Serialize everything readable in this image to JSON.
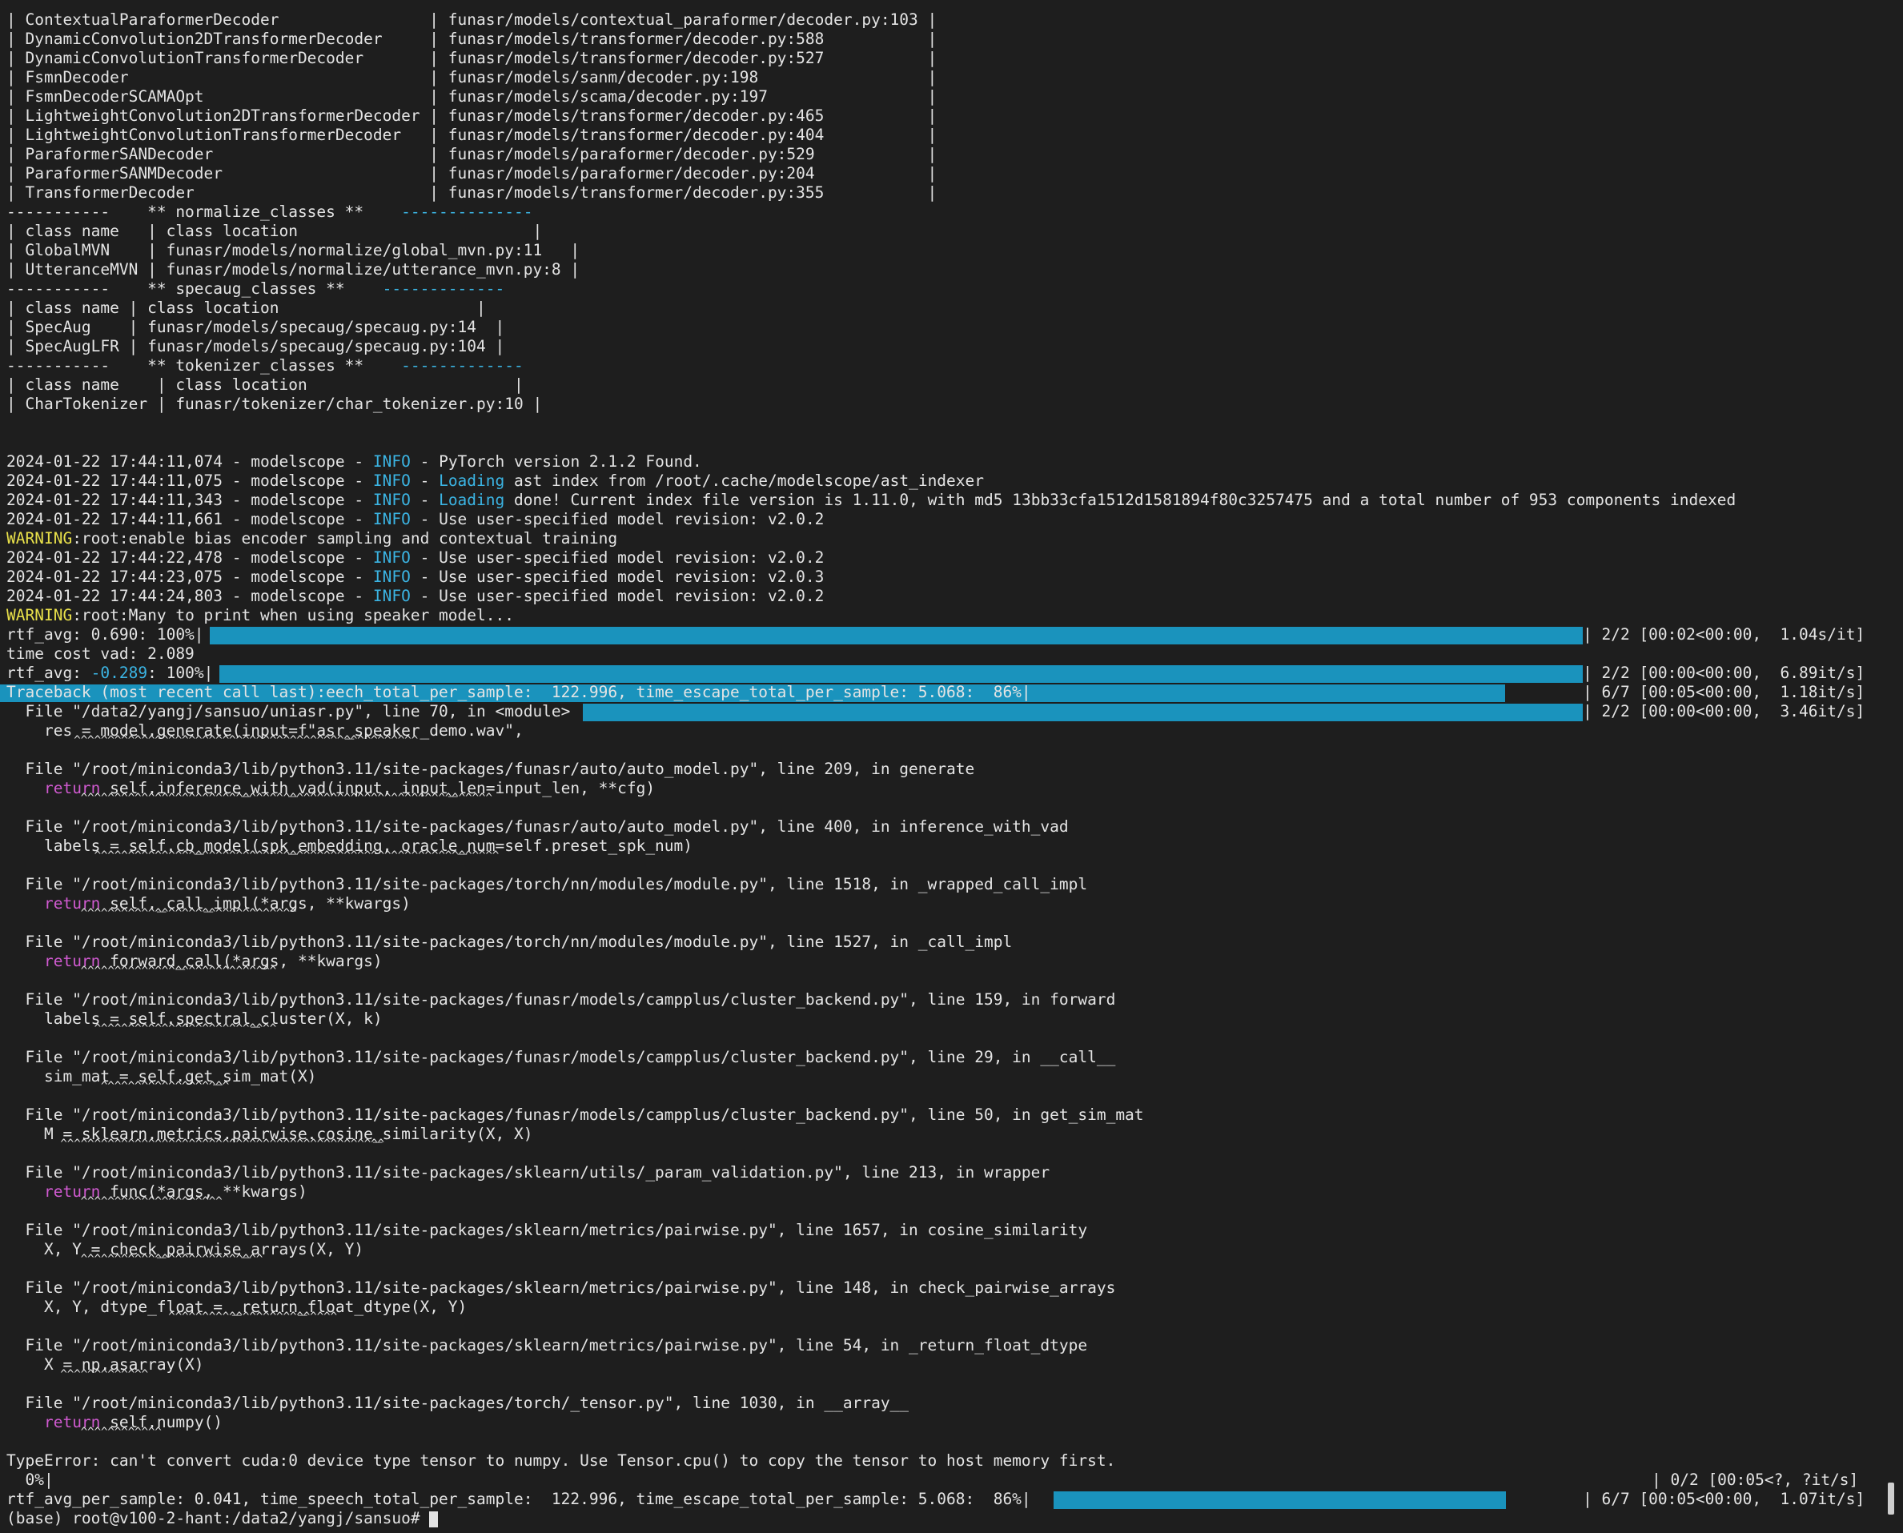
{
  "terminal": {
    "lines": [
      {
        "id": "l01",
        "t": "| ContextualParaformerDecoder                | funasr/models/contextual_paraformer/decoder.py:103 |"
      },
      {
        "id": "l02",
        "t": "| DynamicConvolution2DTransformerDecoder     | funasr/models/transformer/decoder.py:588           |"
      },
      {
        "id": "l03",
        "t": "| DynamicConvolutionTransformerDecoder       | funasr/models/transformer/decoder.py:527           |"
      },
      {
        "id": "l04",
        "t": "| FsmnDecoder                                | funasr/models/sanm/decoder.py:198                  |"
      },
      {
        "id": "l05",
        "t": "| FsmnDecoderSCAMAOpt                        | funasr/models/scama/decoder.py:197                 |"
      },
      {
        "id": "l06",
        "t": "| LightweightConvolution2DTransformerDecoder | funasr/models/transformer/decoder.py:465           |"
      },
      {
        "id": "l07",
        "t": "| LightweightConvolutionTransformerDecoder   | funasr/models/transformer/decoder.py:404           |"
      },
      {
        "id": "l08",
        "t": "| ParaformerSANDecoder                       | funasr/models/paraformer/decoder.py:529            |"
      },
      {
        "id": "l09",
        "t": "| ParaformerSANMDecoder                      | funasr/models/paraformer/decoder.py:204            |"
      },
      {
        "id": "l10",
        "t": "| TransformerDecoder                         | funasr/models/transformer/decoder.py:355           |"
      },
      {
        "id": "l11a",
        "t": "-----------    ** normalize_classes **    ",
        "b": "--------------"
      },
      {
        "id": "l12",
        "t": "| class name   | class location                         |"
      },
      {
        "id": "l13",
        "t": "| GlobalMVN    | funasr/models/normalize/global_mvn.py:11   |"
      },
      {
        "id": "l14",
        "t": "| UtteranceMVN | funasr/models/normalize/utterance_mvn.py:8 |"
      },
      {
        "id": "l15a",
        "t": "-----------    ** specaug_classes **    ",
        "b": "-------------"
      },
      {
        "id": "l16",
        "t": "| class name | class location                     |"
      },
      {
        "id": "l17",
        "t": "| SpecAug    | funasr/models/specaug/specaug.py:14  |"
      },
      {
        "id": "l18",
        "t": "| SpecAugLFR | funasr/models/specaug/specaug.py:104 |"
      },
      {
        "id": "l19a",
        "t": "-----------    ** tokenizer_classes **    ",
        "b": "-------------"
      },
      {
        "id": "l20",
        "t": "| class name    | class location                      |"
      },
      {
        "id": "l21",
        "t": "| CharTokenizer | funasr/tokenizer/char_tokenizer.py:10 |"
      }
    ],
    "logs": [
      {
        "pre": "2024-01-22 17:44:11,074 - modelscope - ",
        "lvl": "INFO",
        "mid": " - ",
        "hl": "",
        "post": "PyTorch version 2.1.2 Found."
      },
      {
        "pre": "2024-01-22 17:44:11,075 - modelscope - ",
        "lvl": "INFO",
        "mid": " - ",
        "hl": "Loading",
        "post": " ast index from /root/.cache/modelscope/ast_indexer"
      },
      {
        "pre": "2024-01-22 17:44:11,343 - modelscope - ",
        "lvl": "INFO",
        "mid": " - ",
        "hl": "Loading",
        "post": " done! Current index file version is 1.11.0, with md5 13bb33cfa1512d1581894f80c3257475 and a total number of 953 components indexed"
      },
      {
        "pre": "2024-01-22 17:44:11,661 - modelscope - ",
        "lvl": "INFO",
        "mid": " - ",
        "hl": "",
        "post": "Use user-specified model revision: v2.0.2"
      }
    ],
    "warning1": {
      "w": "WARNING",
      "rest": ":root:enable bias encoder sampling and contextual training"
    },
    "logs2": [
      {
        "pre": "2024-01-22 17:44:22,478 - modelscope - ",
        "lvl": "INFO",
        "post": " - Use user-specified model revision: v2.0.2"
      },
      {
        "pre": "2024-01-22 17:44:23,075 - modelscope - ",
        "lvl": "INFO",
        "post": " - Use user-specified model revision: v2.0.3"
      },
      {
        "pre": "2024-01-22 17:44:24,803 - modelscope - ",
        "lvl": "INFO",
        "post": " - Use user-specified model revision: v2.0.2"
      }
    ],
    "warning2": {
      "w": "WARNING",
      "rest": ":root:Many to print when using speaker model..."
    },
    "progress1": {
      "label": "rtf_avg: 0.690: 100%|",
      "right": "| 2/2 [00:02<00:00,  1.04s/it]",
      "fraction": 1.0
    },
    "timecost": "time cost vad: 2.089",
    "progress2": {
      "label_a": "rtf_avg: ",
      "label_neg": "-0.289",
      "label_b": ": 100%|",
      "right": "| 2/2 [00:00<00:00,  6.89it/s]",
      "fraction": 1.0
    },
    "progress3": {
      "label": "Traceback (most recent call last):eech_total_per_sample:  122.996, time_escape_total_per_sample: 5.068:  86%|",
      "right": "| 6/7 [00:05<00:00,  1.18it/s]",
      "fraction": 0.86
    },
    "progress4": {
      "label": "  File \"/data2/yangj/sansuo/uniasr.py\", line 70, in <module>",
      "right": "| 2/2 [00:00<00:00,  3.46it/s]",
      "fraction": 1.0
    },
    "tb_first_code": "    res = model.generate(input=f\"asr_speaker_demo.wav\",",
    "tb_first_caret": "          ^^^^^^^^^^^^^^^^^^^^^^^^^^^^^^^^^^^^^^^^^^^^^^^^^^^",
    "frames": [
      {
        "file": "  File \"/root/miniconda3/lib/python3.11/site-packages/funasr/auto/auto_model.py\", line 209, in generate",
        "kw": "return",
        "code": " self.inference_with_vad(input, input_len=input_len, **cfg)",
        "caret": "           ^^^^^^^^^^^^^^^^^^^^^^^^^^^^^^^^^^^^^^^^^^^^^^^^^^^^^^^^^^^^^"
      },
      {
        "file": "  File \"/root/miniconda3/lib/python3.11/site-packages/funasr/auto/auto_model.py\", line 400, in inference_with_vad",
        "kw": "",
        "code": "    labels = self.cb_model(spk_embedding, oracle_num=self.preset_spk_num)",
        "caret": "             ^^^^^^^^^^^^^^^^^^^^^^^^^^^^^^^^^^^^^^^^^^^^^^^^^^^^^^^^^^^^"
      },
      {
        "file": "  File \"/root/miniconda3/lib/python3.11/site-packages/torch/nn/modules/module.py\", line 1518, in _wrapped_call_impl",
        "kw": "return",
        "code": " self._call_impl(*args, **kwargs)",
        "caret": "           ^^^^^^^^^^^^^^^^^^^^^^^^^^^^^^^^"
      },
      {
        "file": "  File \"/root/miniconda3/lib/python3.11/site-packages/torch/nn/modules/module.py\", line 1527, in _call_impl",
        "kw": "return",
        "code": " forward_call(*args, **kwargs)",
        "caret": "           ^^^^^^^^^^^^^^^^^^^^^^^^^^^^^"
      },
      {
        "file": "  File \"/root/miniconda3/lib/python3.11/site-packages/funasr/models/campplus/cluster_backend.py\", line 159, in forward",
        "kw": "",
        "code": "    labels = self.spectral_cluster(X, k)",
        "caret": "             ^^^^^^^^^^^^^^^^^^^^^^^^^^^"
      },
      {
        "file": "  File \"/root/miniconda3/lib/python3.11/site-packages/funasr/models/campplus/cluster_backend.py\", line 29, in __call__",
        "kw": "",
        "code": "    sim_mat = self.get_sim_mat(X)",
        "caret": "              ^^^^^^^^^^^^^^^^^^^"
      },
      {
        "file": "  File \"/root/miniconda3/lib/python3.11/site-packages/funasr/models/campplus/cluster_backend.py\", line 50, in get_sim_mat",
        "kw": "",
        "code": "    M = sklearn.metrics.pairwise.cosine_similarity(X, X)",
        "caret": "        ^^^^^^^^^^^^^^^^^^^^^^^^^^^^^^^^^^^^^^^^^^^^^^^^"
      },
      {
        "file": "  File \"/root/miniconda3/lib/python3.11/site-packages/sklearn/utils/_param_validation.py\", line 213, in wrapper",
        "kw": "return",
        "code": " func(*args, **kwargs)",
        "caret": "           ^^^^^^^^^^^^^^^^^^^^^"
      },
      {
        "file": "  File \"/root/miniconda3/lib/python3.11/site-packages/sklearn/metrics/pairwise.py\", line 1657, in cosine_similarity",
        "kw": "",
        "code": "    X, Y = check_pairwise_arrays(X, Y)",
        "caret": "           ^^^^^^^^^^^^^^^^^^^^^^^^^^^"
      },
      {
        "file": "  File \"/root/miniconda3/lib/python3.11/site-packages/sklearn/metrics/pairwise.py\", line 148, in check_pairwise_arrays",
        "kw": "",
        "code": "    X, Y, dtype_float = _return_float_dtype(X, Y)",
        "caret": "                        ^^^^^^^^^^^^^^^^^^^^^^^^^"
      },
      {
        "file": "  File \"/root/miniconda3/lib/python3.11/site-packages/sklearn/metrics/pairwise.py\", line 54, in _return_float_dtype",
        "kw": "",
        "code": "    X = np.asarray(X)",
        "caret": "        ^^^^^^^^^^^^^"
      },
      {
        "file": "  File \"/root/miniconda3/lib/python3.11/site-packages/torch/_tensor.py\", line 1030, in __array__",
        "kw": "return",
        "code": " self.numpy()",
        "caret": "           ^^^^^^^^^^^^"
      }
    ],
    "error": "TypeError: can't convert cuda:0 device type tensor to numpy. Use Tensor.cpu() to copy the tensor to host memory first.",
    "progress5": {
      "label": "  0%|",
      "right": "| 0/2 [00:05<?, ?it/s]",
      "fraction": 0
    },
    "progress6": {
      "label": "rtf_avg_per_sample: 0.041, time_speech_total_per_sample:  122.996, time_escape_total_per_sample: 5.068:  86%|",
      "right": "| 6/7 [00:05<00:00,  1.07it/s]",
      "fraction": 0.86
    },
    "prompt": "(base) root@v100-2-hant:/data2/yangj/sansuo# "
  },
  "colors": {
    "background": "#1e1e1e",
    "text": "#e4e4e4",
    "info": "#3bb4e3",
    "warning": "#e8e04a",
    "keyword": "#d05ad0",
    "progress": "#1a93bd"
  }
}
